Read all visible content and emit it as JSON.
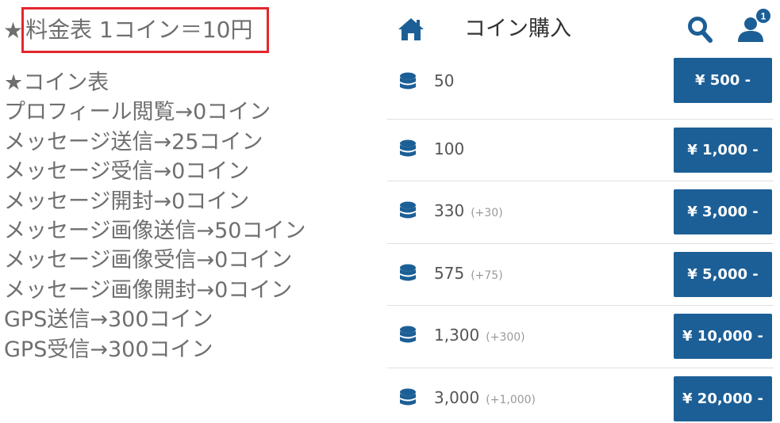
{
  "info": {
    "rate": {
      "star": "★",
      "text": "料金表 1コイン＝10円"
    },
    "coin_table": [
      "★コイン表",
      "プロフィール閲覧→0コイン",
      "メッセージ送信→25コイン",
      "メッセージ受信→0コイン",
      "メッセージ開封→0コイン",
      "メッセージ画像送信→50コイン",
      "メッセージ画像受信→0コイン",
      "メッセージ画像開封→0コイン",
      "GPS送信→300コイン",
      "GPS受信→300コイン"
    ]
  },
  "header": {
    "title": "コイン購入",
    "notification_count": "1",
    "icons": [
      "home-icon",
      "search-icon",
      "user-icon"
    ]
  },
  "packages": [
    {
      "amount": "50",
      "bonus": "",
      "price": "¥ 500 -"
    },
    {
      "amount": "100",
      "bonus": "",
      "price": "¥ 1,000 -"
    },
    {
      "amount": "330",
      "bonus": "(+30)",
      "price": "¥ 3,000 -"
    },
    {
      "amount": "575",
      "bonus": "(+75)",
      "price": "¥ 5,000 -"
    },
    {
      "amount": "1,300",
      "bonus": "(+300)",
      "price": "¥ 10,000 -"
    },
    {
      "amount": "3,000",
      "bonus": "(+1,000)",
      "price": "¥ 20,000 -"
    }
  ],
  "colors": {
    "accent": "#1c5f96",
    "highlight_border": "#e3262d",
    "info_text": "#6f6f6f"
  }
}
